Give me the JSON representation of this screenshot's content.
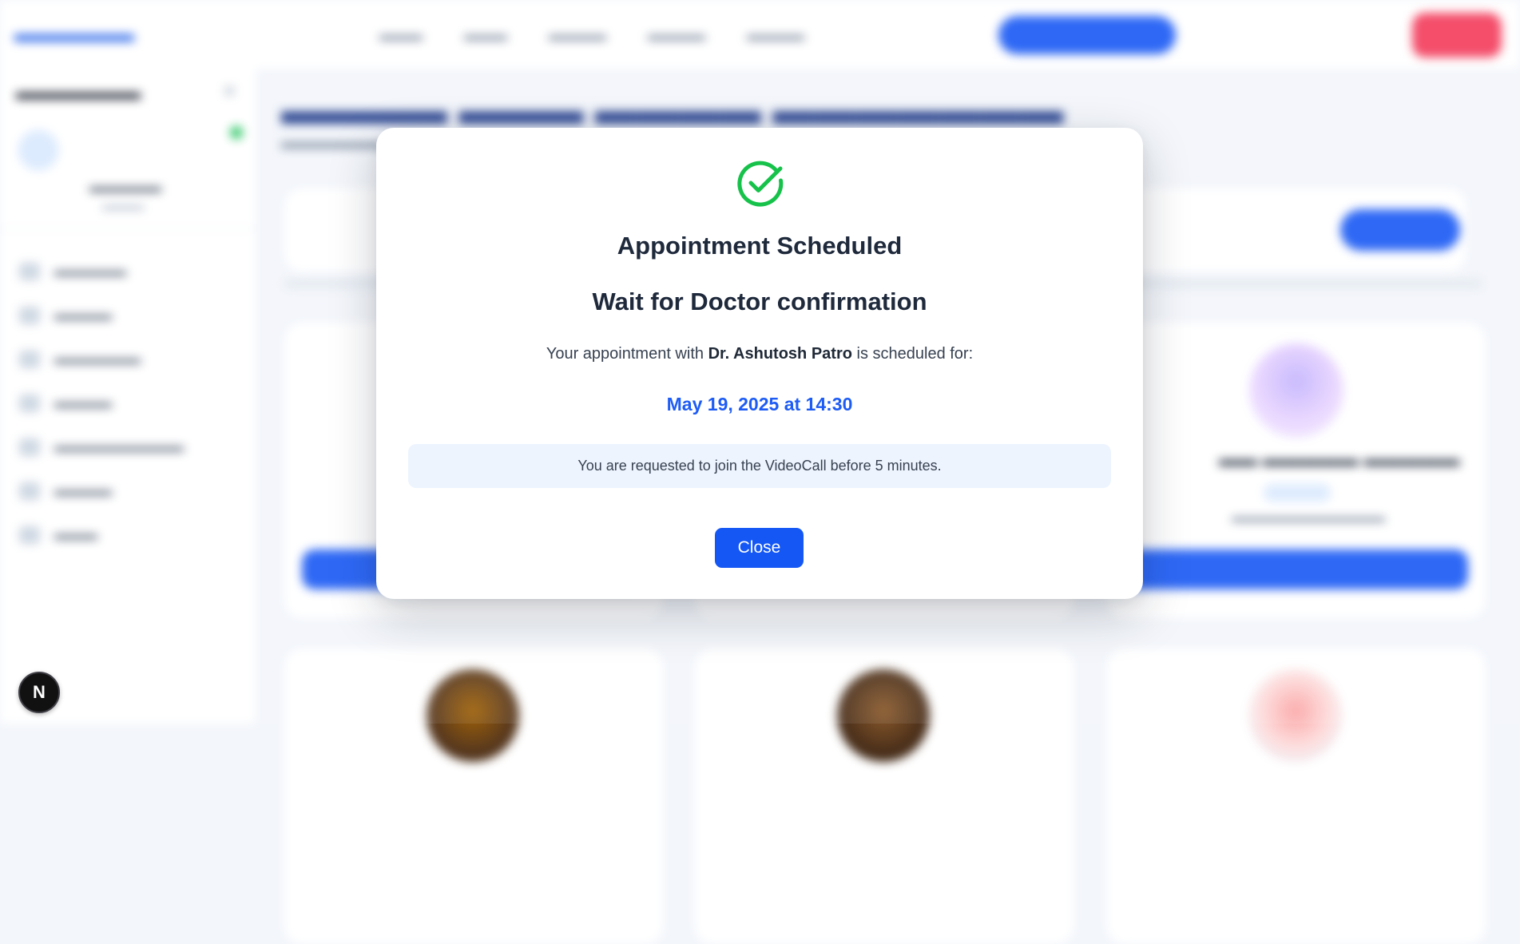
{
  "modal": {
    "title": "Appointment Scheduled",
    "subtitle": "Wait for Doctor confirmation",
    "message_prefix": "Your appointment with",
    "doctor_name": "Dr. Ashutosh Patro",
    "message_suffix": "is scheduled for:",
    "datetime": "May 19, 2025 at 14:30",
    "notice": "You are requested to join the VideoCall before 5 minutes.",
    "close_label": "Close",
    "icon": "check-circle-icon"
  },
  "dev_badge": {
    "label": "N"
  },
  "colors": {
    "accent": "#1457f5",
    "date_text": "#1d5cf5",
    "success": "#16c24a",
    "notice_bg": "#edf4fe",
    "danger": "#f43f5e"
  }
}
